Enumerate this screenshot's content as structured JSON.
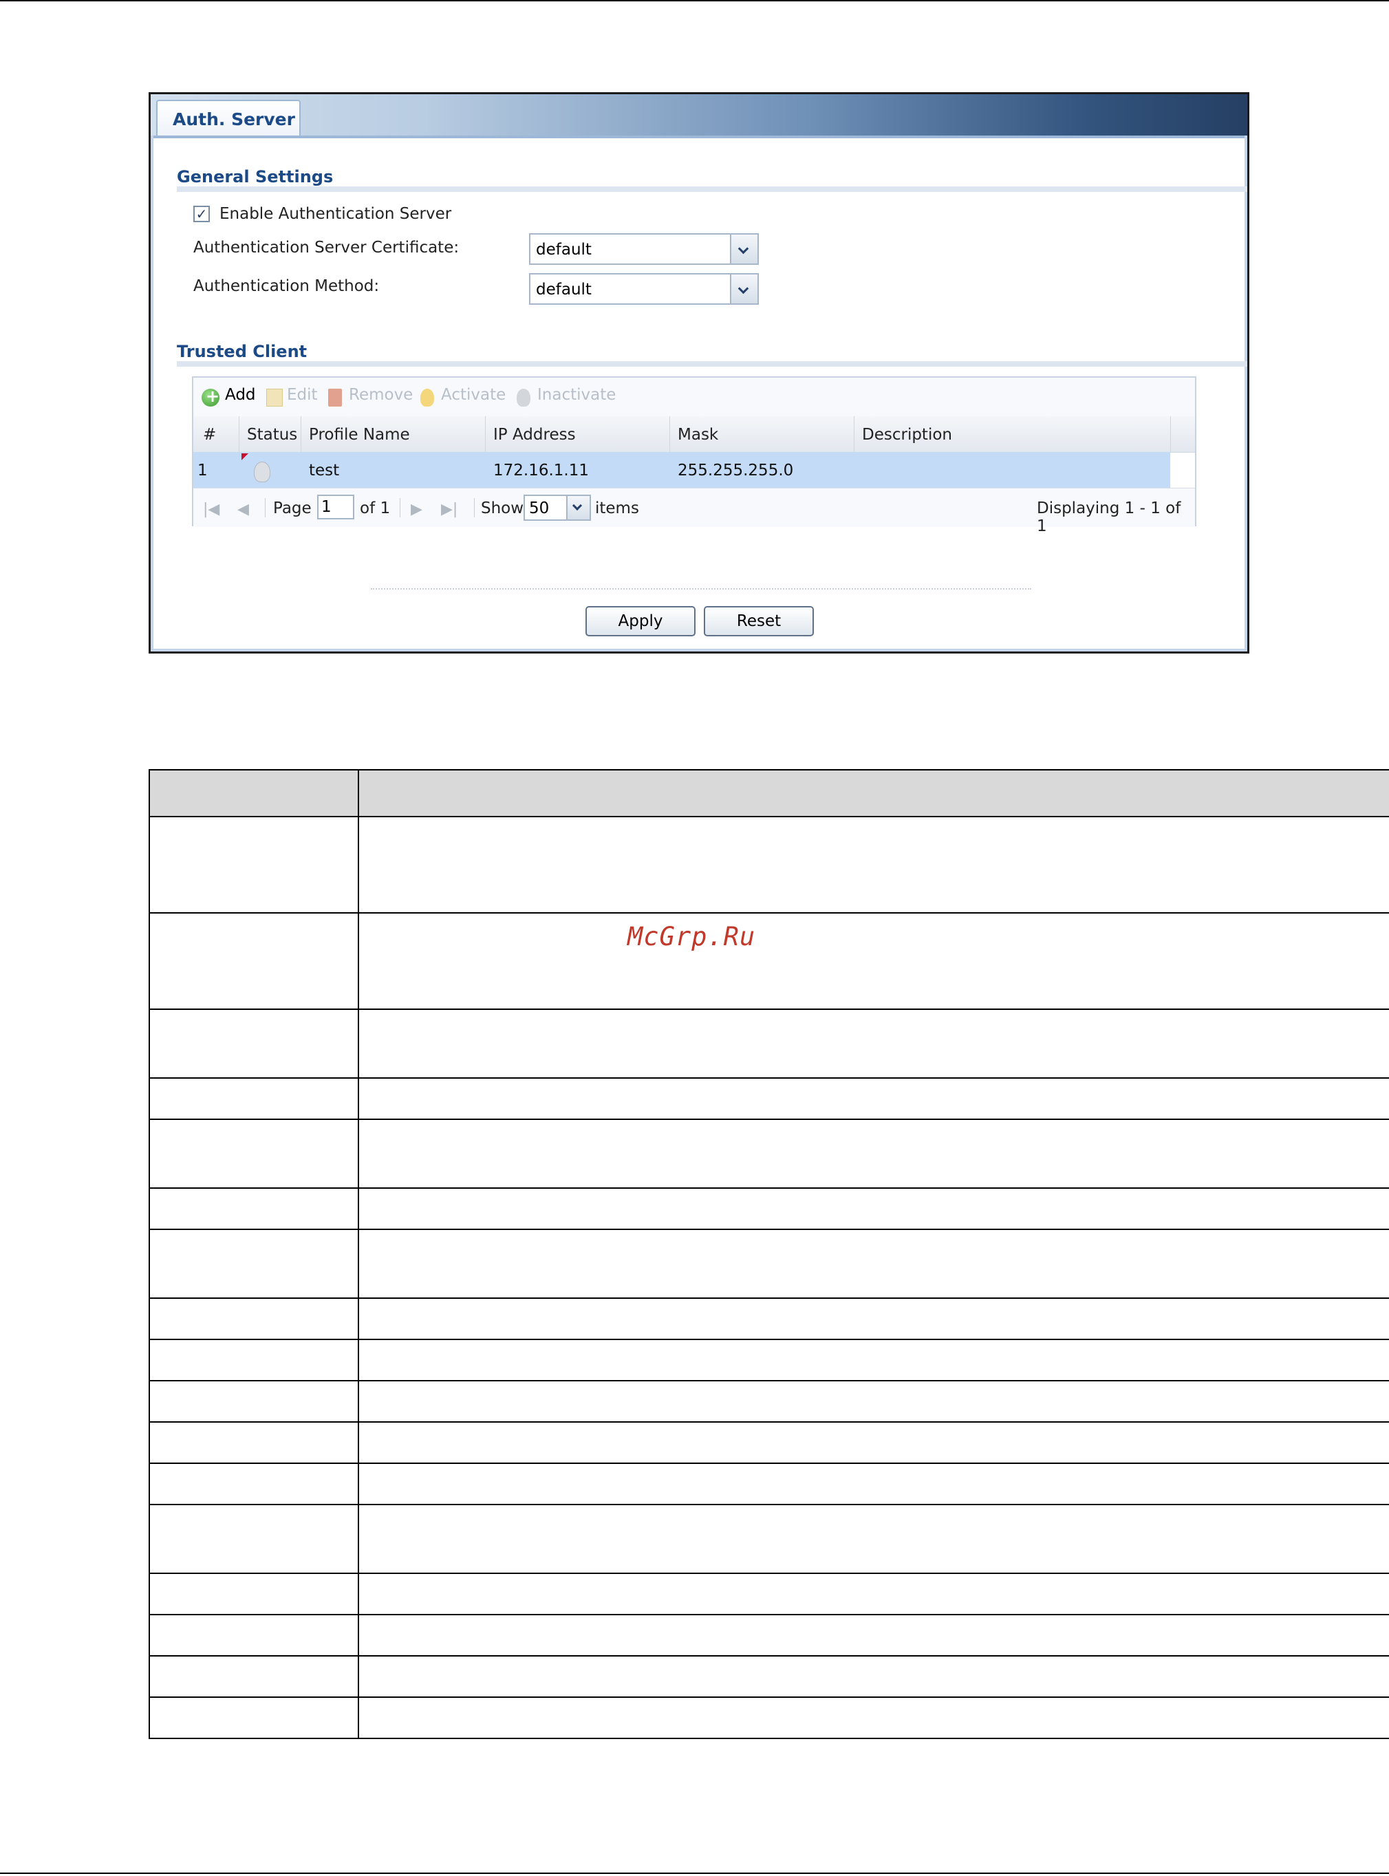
{
  "panel": {
    "tab_label": "Auth. Server",
    "general_settings": {
      "title": "General Settings",
      "enable_checkbox": {
        "label": "Enable Authentication Server",
        "checked": true
      },
      "certificate": {
        "label": "Authentication Server Certificate:",
        "value": "default"
      },
      "method": {
        "label": "Authentication Method:",
        "value": "default"
      }
    },
    "trusted_client": {
      "title": "Trusted Client",
      "toolbar": {
        "add": "Add",
        "edit": "Edit",
        "remove": "Remove",
        "activate": "Activate",
        "inactivate": "Inactivate"
      },
      "columns": [
        "#",
        "Status",
        "Profile Name",
        "IP Address",
        "Mask",
        "Description"
      ],
      "rows": [
        {
          "index": "1",
          "profile_name": "test",
          "ip_address": "172.16.1.11",
          "mask": "255.255.255.0",
          "description": ""
        }
      ],
      "pager": {
        "page_label": "Page",
        "page_value": "1",
        "of_label": "of 1",
        "show_label": "Show",
        "show_value": "50",
        "items_label": "items",
        "displaying": "Displaying 1 - 1 of 1"
      }
    },
    "buttons": {
      "apply": "Apply",
      "reset": "Reset"
    }
  },
  "watermark": "McGrp.Ru",
  "doc_table": {
    "row_count": 16
  }
}
